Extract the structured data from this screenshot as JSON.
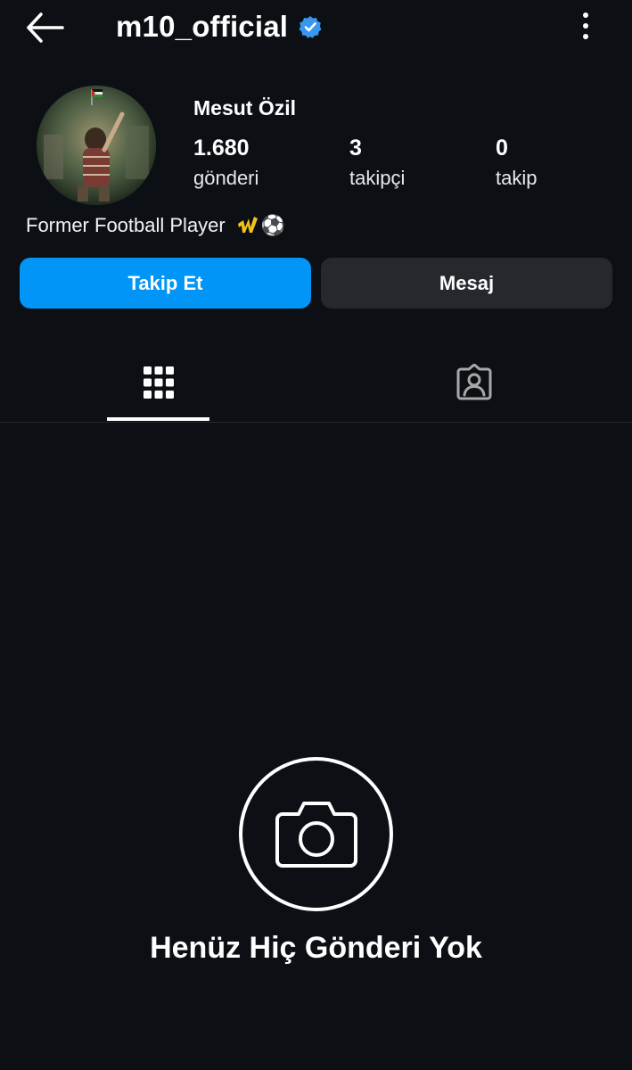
{
  "header": {
    "username": "m10_official",
    "back_icon": "arrow-left-icon",
    "verified_icon": "verified-badge-icon",
    "more_icon": "more-vertical-icon"
  },
  "profile": {
    "display_name": "Mesut Özil",
    "stats": {
      "posts": {
        "value": "1.680",
        "label": "gönderi"
      },
      "followers": {
        "value": "3",
        "label": "takipçi"
      },
      "following": {
        "value": "0",
        "label": "takip"
      }
    },
    "bio": "Former Football Player",
    "bio_emoji": "⚽",
    "bio_icons": [
      "m10-logo-icon",
      "soccer-ball-icon"
    ]
  },
  "actions": {
    "follow_label": "Takip Et",
    "message_label": "Mesaj"
  },
  "tabs": [
    {
      "icon": "grid-icon",
      "active": true
    },
    {
      "icon": "tagged-user-icon",
      "active": false
    }
  ],
  "empty_state": {
    "icon": "camera-icon",
    "title": "Henüz Hiç Gönderi Yok"
  },
  "colors": {
    "background": "#0c1015",
    "follow_button": "#0095f6",
    "message_button": "#25292e",
    "verified": "#3897f0"
  }
}
